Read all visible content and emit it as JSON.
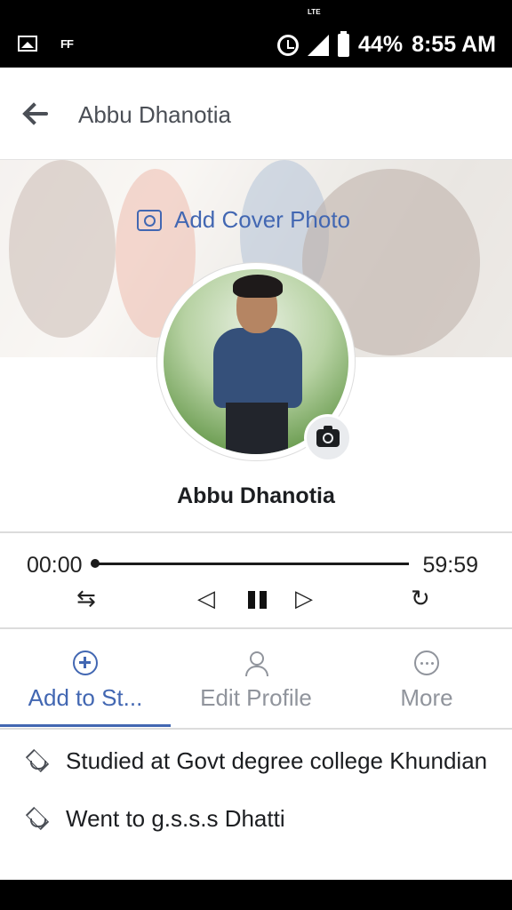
{
  "status_bar": {
    "left_label": "FF",
    "network": "LTE",
    "battery": "44%",
    "time": "8:55 AM"
  },
  "header": {
    "title": "Abbu Dhanotia"
  },
  "cover": {
    "add_cover_label": "Add Cover Photo"
  },
  "profile": {
    "name": "Abbu Dhanotia"
  },
  "media": {
    "elapsed": "00:00",
    "total": "59:59",
    "progress": 0,
    "shuffle_glyph": "⇆",
    "prev_glyph": "◁",
    "next_glyph": "▷",
    "repeat_glyph": "↻"
  },
  "actions": [
    {
      "label": "Add to St...",
      "icon": "add-circle-icon",
      "active": true
    },
    {
      "label": "Edit Profile",
      "icon": "edit-person-icon",
      "active": false
    },
    {
      "label": "More",
      "icon": "more-dots-icon",
      "active": false
    }
  ],
  "info": [
    {
      "icon": "graduation-cap-icon",
      "text": "Studied at Govt degree college Khundian"
    },
    {
      "icon": "graduation-cap-icon",
      "text": "Went to g.s.s.s Dhatti"
    }
  ],
  "colors": {
    "accent": "#4267b2",
    "text": "#1c1e21",
    "muted": "#90949c"
  }
}
